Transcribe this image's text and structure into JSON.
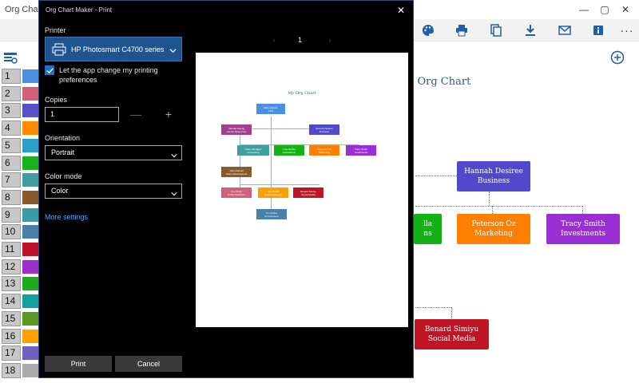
{
  "app": {
    "title": "Org Chart M",
    "chart_title": "y Org Chart",
    "window_controls": [
      "—",
      "▢",
      "✕"
    ],
    "toolbar_icons": [
      "palette-icon",
      "printer-icon",
      "copy-icon",
      "download-icon",
      "mail-icon",
      "info-icon"
    ],
    "more_label": "···",
    "row_numbers": [
      "1",
      "2",
      "3",
      "4",
      "5",
      "6",
      "7",
      "8",
      "9",
      "10",
      "11",
      "12",
      "13",
      "14",
      "15",
      "16",
      "17",
      "18"
    ],
    "row_colors": [
      "#4a90e2",
      "#d45f78",
      "#5b4fc9",
      "#ff8c00",
      "#2a9fc9",
      "#19b21e",
      "#3f9fa0",
      "#8b5a2b",
      "#3b9aa8",
      "#4a7fa8",
      "#c0102a",
      "#9b30c9",
      "#1eab1e",
      "#119f9f",
      "#5a9a20",
      "#ff9f00",
      "#7060c0",
      "#aaaaaa"
    ],
    "nodes": {
      "hannah": {
        "name": "Hannah Desiree",
        "role": "Business"
      },
      "green_partial": {
        "name": "lla",
        "role": "ns"
      },
      "peterson": {
        "name": "Peterson Oz",
        "role": "Marketing"
      },
      "tracy": {
        "name": "Tracy Smith",
        "role": "Investments"
      },
      "benard": {
        "name": "Benard Simiyu",
        "role": "Social Media"
      }
    },
    "colors": {
      "hannah": "#5148cc",
      "green": "#15b215",
      "peterson": "#ff7f00",
      "tracy": "#9b2fd6",
      "benard": "#c01525"
    }
  },
  "dialog": {
    "title": "Org Chart Maker - Print",
    "close": "✕",
    "printer_label": "Printer",
    "printer_name": "HP Photosmart C4700 series",
    "pref_checked": true,
    "pref_text": "Let the app change my printing preferences",
    "copies_label": "Copies",
    "copies_value": "1",
    "minus": "—",
    "plus": "+",
    "orientation_label": "Orientation",
    "orientation_value": "Portrait",
    "color_mode_label": "Color mode",
    "color_mode_value": "Color",
    "more_settings": "More settings",
    "print_button": "Print",
    "cancel_button": "Cancel",
    "page_number": "1",
    "prev": "‹",
    "next": "›"
  },
  "preview": {
    "title": "My Org Chart",
    "nodes": [
      {
        "name": "Mary Hassan",
        "role": "CEO",
        "color": "#4a90e2"
      },
      {
        "name": "Claudia Kaunig",
        "role": "Human Resources",
        "color": "#a0408f"
      },
      {
        "name": "Hannah Desiree",
        "role": "Business",
        "color": "#5148cc"
      },
      {
        "name": "Hillary Muragah",
        "role": "Accounting",
        "color": "#3f9fa0"
      },
      {
        "name": "Lisa Sheilla",
        "role": "Acquisitions",
        "color": "#15b215"
      },
      {
        "name": "Peterson Oz",
        "role": "Marketing",
        "color": "#ff7f00"
      },
      {
        "name": "Tracy Smith",
        "role": "Investments",
        "color": "#9b2fd6"
      },
      {
        "name": "Julia Mutheki",
        "role": "Talent Development",
        "color": "#8b5a2b"
      },
      {
        "name": "Sue Smith",
        "role": "Public Relations",
        "color": "#d45f78"
      },
      {
        "name": "Joe Drood",
        "role": "Global Research",
        "color": "#ff9f00"
      },
      {
        "name": "Benard Simiyu",
        "role": "Social Media",
        "color": "#c01525"
      },
      {
        "name": "Tim Mutiso",
        "role": "Procurement",
        "color": "#4a7fa8"
      }
    ]
  }
}
